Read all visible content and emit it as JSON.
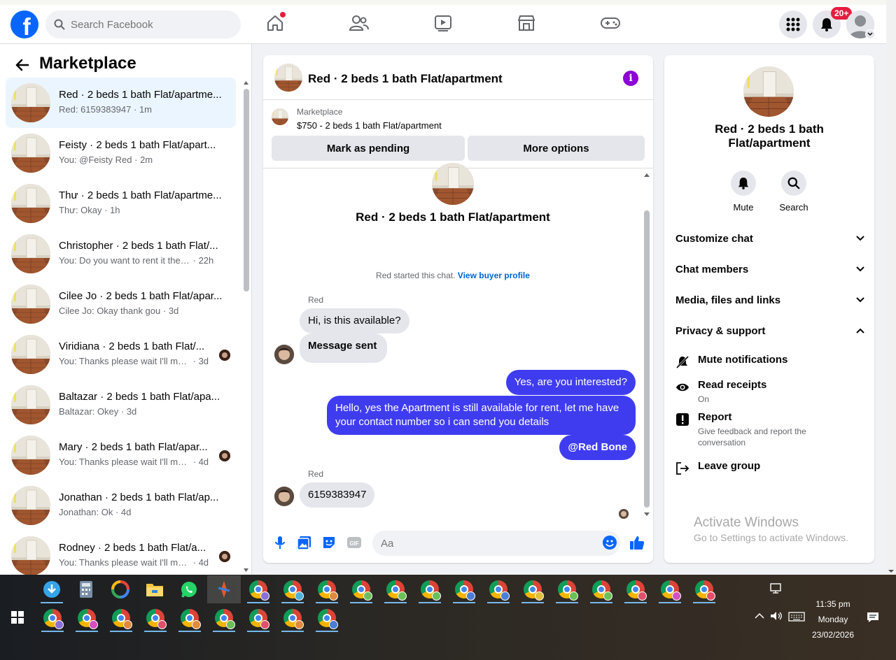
{
  "topbar": {
    "logo": "f",
    "search_placeholder": "Search Facebook",
    "notification_count": "20+",
    "icons": [
      "home-icon",
      "friends-icon",
      "watch-icon",
      "marketplace-icon",
      "gaming-icon",
      "menu-grid-icon",
      "bell-icon"
    ]
  },
  "sidebar": {
    "title": "Marketplace",
    "conversations": [
      {
        "title": "Red · 2 beds 1 bath Flat/apartme...",
        "sub": "Red: 6159383947",
        "time": "1m",
        "active": true
      },
      {
        "title": "Feisty · 2 beds 1 bath Flat/apart...",
        "sub": "You: @Feisty Red",
        "time": "2m"
      },
      {
        "title": "Thư · 2 beds 1 bath Flat/apartme...",
        "sub": "Thư: Okay",
        "time": "1h"
      },
      {
        "title": "Christopher · 2 beds 1 bath Flat/...",
        "sub": "You: Do you want to rent it the ap...",
        "time": "22h"
      },
      {
        "title": "Cilee Jo · 2 beds 1 bath Flat/apar...",
        "sub": "Cilee Jo: Okay thank gou",
        "time": "3d"
      },
      {
        "title": "Viridiana · 2 beds 1 bath Flat/...",
        "sub": "You: Thanks please wait I'll mess...",
        "time": "3d",
        "seen": true
      },
      {
        "title": "Baltazar · 2 beds 1 bath Flat/apa...",
        "sub": "Baltazar: Okey",
        "time": "3d"
      },
      {
        "title": "Mary · 2 beds 1 bath Flat/apar...",
        "sub": "You: Thanks please wait I'll mess...",
        "time": "4d",
        "seen": true
      },
      {
        "title": "Jonathan · 2 beds 1 bath Flat/ap...",
        "sub": "Jonathan: Ok",
        "time": "4d"
      },
      {
        "title": "Rodney · 2 beds 1 bath Flat/a...",
        "sub": "You: Thanks please wait I'll mess...",
        "time": "4d",
        "seen": true
      }
    ]
  },
  "chat": {
    "title": "Red · 2 beds 1 bath Flat/apartment",
    "info_icon": "i",
    "listing": {
      "source": "Marketplace",
      "title": "$750 - 2 beds 1 bath Flat/apartment",
      "mark_pending": "Mark as pending",
      "more_options": "More options"
    },
    "intro_title": "Red · 2 beds 1 bath Flat/apartment",
    "intro_note": "Red started this chat.",
    "intro_link": "View buyer profile",
    "messages": {
      "sender1": "Red",
      "m1": "Hi, is this available?",
      "m2": "Message sent",
      "m3": "Yes, are you interested?",
      "m4": "Hello, yes the Apartment is still available for rent, let me have your contact number so i can send you details",
      "m5": "@Red Bone",
      "sender2": "Red",
      "m6": "6159383947"
    },
    "composer_placeholder": "Aa"
  },
  "details": {
    "title": "Red · 2 beds 1 bath Flat/apartment",
    "mute_label": "Mute",
    "search_label": "Search",
    "sections": {
      "customize": "Customize chat",
      "members": "Chat members",
      "media": "Media, files and links",
      "privacy": "Privacy & support"
    },
    "items": {
      "mute_notifications": "Mute notifications",
      "read_receipts": "Read receipts",
      "read_receipts_value": "On",
      "report": "Report",
      "report_sub": "Give feedback and report the conversation",
      "leave": "Leave group"
    }
  },
  "watermark": {
    "line1": "Activate Windows",
    "line2": "Go to Settings to activate Windows."
  },
  "taskbar": {
    "time": "11:35 pm",
    "day": "Monday",
    "date": "23/02/2026"
  },
  "colors": {
    "brand": "#0866ff",
    "outgoing_bubble": "#3f3cf0",
    "incoming_bubble": "#e4e6eb",
    "info_purple": "#8a05d6",
    "badge_red": "#e41e3f"
  }
}
